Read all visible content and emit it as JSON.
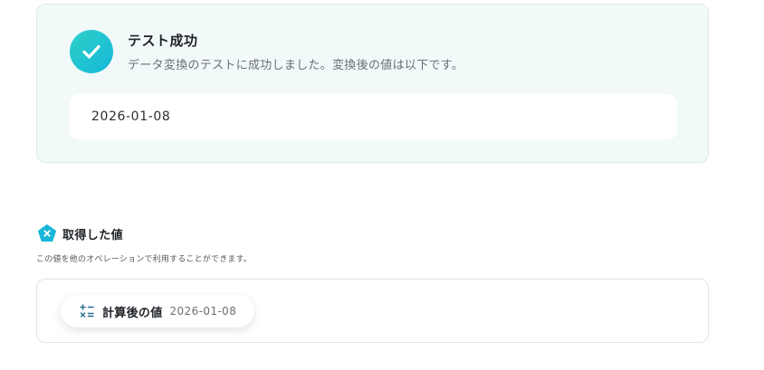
{
  "success": {
    "title": "テスト成功",
    "description": "データ変換のテストに成功しました。変換後の値は以下です。",
    "result_value": "2026-01-08"
  },
  "acquired": {
    "title": "取得した値",
    "subtitle": "この値を他のオペレーションで利用することができます。",
    "items": [
      {
        "label": "計算後の値",
        "value": "2026-01-08",
        "icon": "calculator-icon"
      }
    ]
  },
  "colors": {
    "accent": "#18bfd4",
    "card_bg": "#f2f9f9"
  }
}
